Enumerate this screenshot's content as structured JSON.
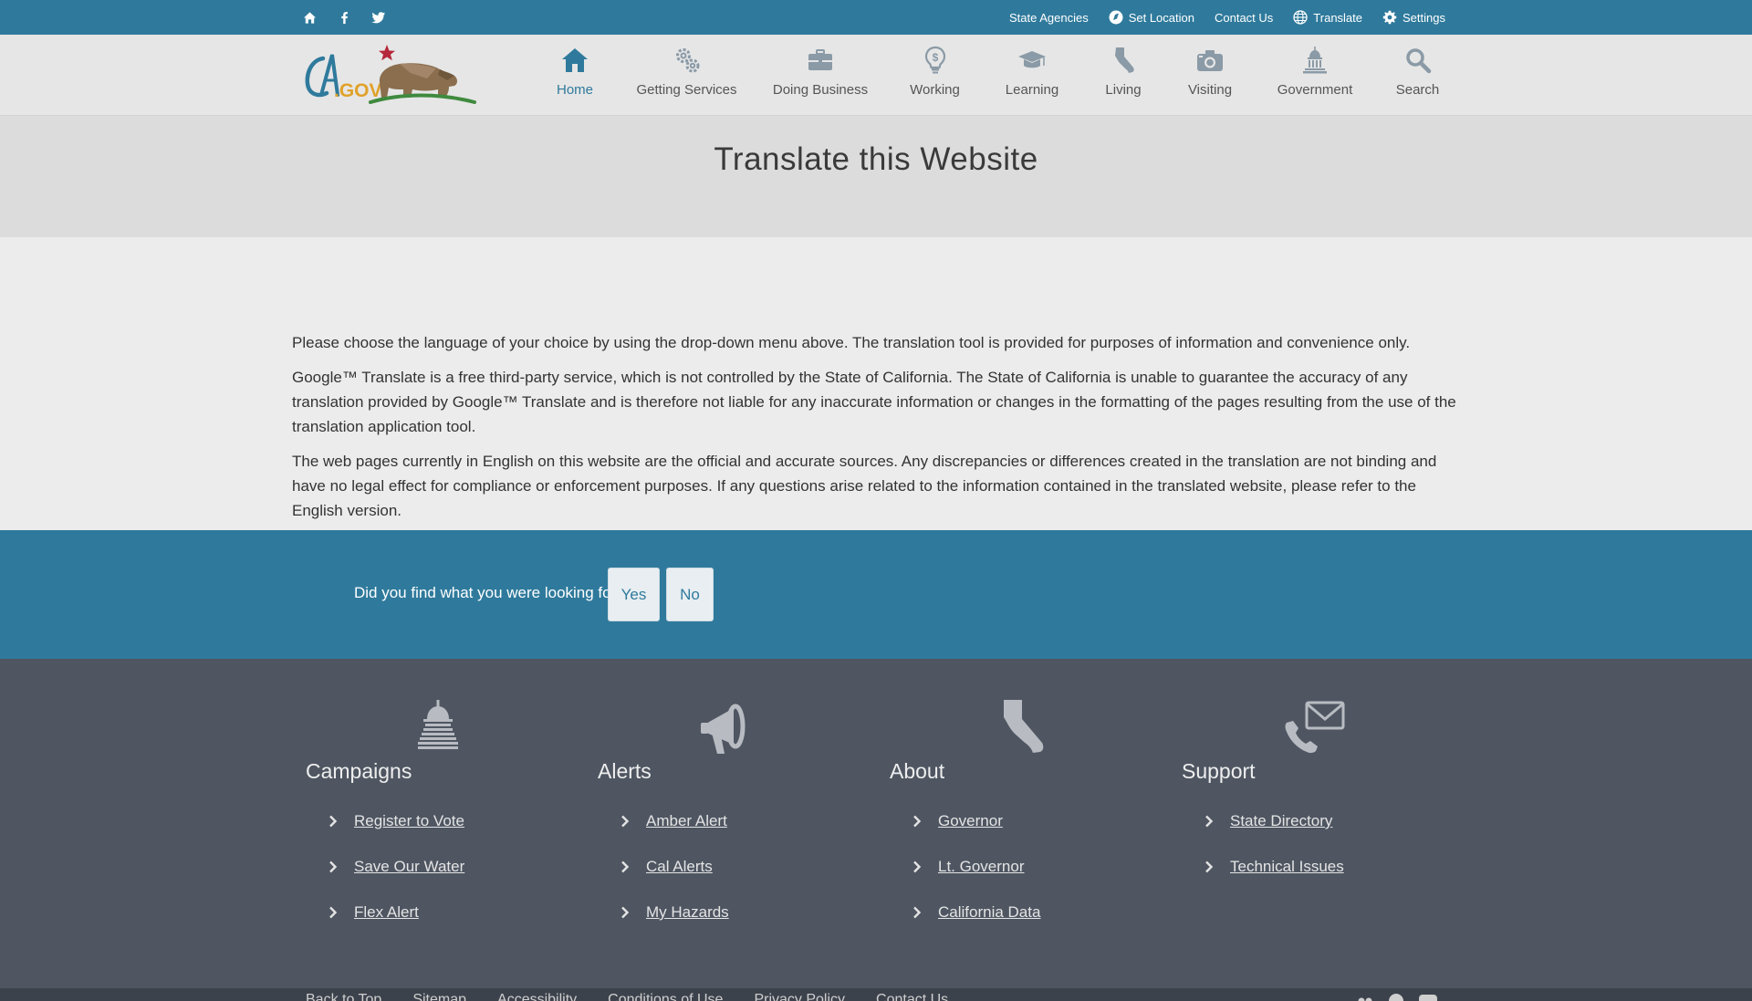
{
  "utility": {
    "social": [
      "home-icon",
      "facebook-icon",
      "twitter-icon"
    ],
    "links": {
      "state_agencies": "State Agencies",
      "set_location": "Set Location",
      "contact_us": "Contact Us",
      "translate": "Translate",
      "settings": "Settings"
    }
  },
  "header": {
    "logo_text": "CA.GOV",
    "nav": [
      {
        "label": "Home",
        "icon": "home-icon",
        "active": true
      },
      {
        "label": "Getting Services",
        "icon": "gears-icon"
      },
      {
        "label": "Doing Business",
        "icon": "briefcase-icon"
      },
      {
        "label": "Working",
        "icon": "lightbulb-dollar-icon"
      },
      {
        "label": "Learning",
        "icon": "graduation-cap-icon"
      },
      {
        "label": "Living",
        "icon": "california-icon"
      },
      {
        "label": "Visiting",
        "icon": "camera-icon"
      },
      {
        "label": "Government",
        "icon": "capitol-icon"
      },
      {
        "label": "Search",
        "icon": "search-icon"
      }
    ]
  },
  "page": {
    "title": "Translate this Website",
    "paragraphs": [
      "Please choose the language of your choice by using the drop-down menu above. The translation tool is provided for purposes of information and convenience only.",
      "Google™ Translate is a free third-party service, which is not controlled by the State of California. The State of California is unable to guarantee the accuracy of any translation provided by Google™ Translate and is therefore not liable for any inaccurate information or changes in the formatting of the pages resulting from the use of the translation application tool.",
      "The web pages currently in English on this website are the official and accurate sources. Any discrepancies or differences created in the translation are not binding and have no legal effect for compliance or enforcement purposes. If any questions arise related to the information contained in the translated website, please refer to the English version."
    ]
  },
  "feedback": {
    "question": "Did you find what you were looking for?",
    "yes": "Yes",
    "no": "No"
  },
  "footer": {
    "columns": [
      {
        "heading": "Campaigns",
        "icon": "capitol-icon",
        "links": [
          "Register to Vote",
          "Save Our Water",
          "Flex Alert"
        ]
      },
      {
        "heading": "Alerts",
        "icon": "megaphone-icon",
        "links": [
          "Amber Alert",
          "Cal Alerts",
          "My Hazards"
        ]
      },
      {
        "heading": "About",
        "icon": "california-icon",
        "links": [
          "Governor",
          "Lt. Governor",
          "California Data"
        ]
      },
      {
        "heading": "Support",
        "icon": "phone-mail-icon",
        "links": [
          "State Directory",
          "Technical Issues"
        ]
      }
    ],
    "bottom_links": [
      "Back to Top",
      "Sitemap",
      "Accessibility",
      "Conditions of Use",
      "Privacy Policy",
      "Contact Us"
    ]
  },
  "colors": {
    "primary": "#2f7a9c",
    "footer": "#4f5662",
    "nav_icon": "#8a9aa6"
  }
}
